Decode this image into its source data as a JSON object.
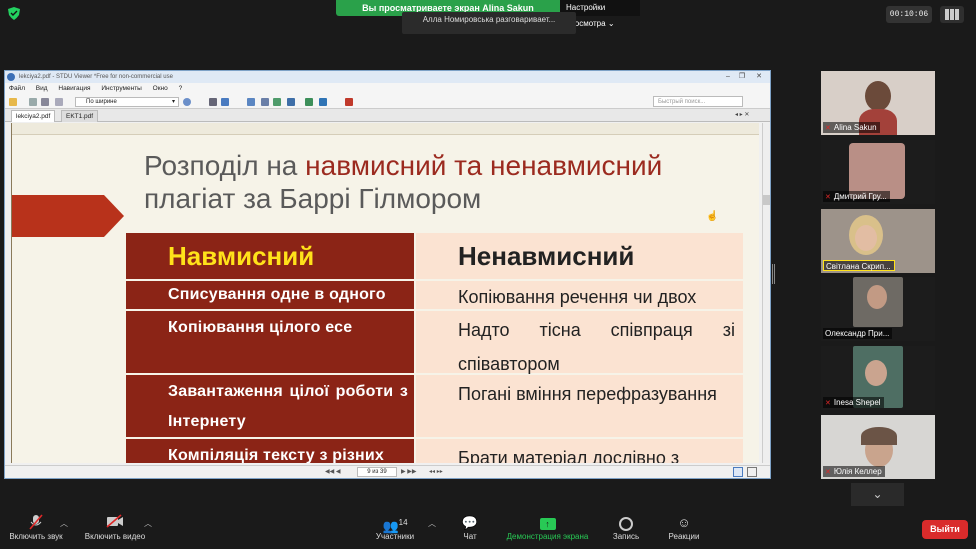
{
  "banner": {
    "viewing_text": "Вы просматриваете экран Alina Sakun",
    "view_options": "Настройки просмотра",
    "speaker_text": "Алла Номировська разговаривает..."
  },
  "timer": "00:10:06",
  "viewer": {
    "window_title": "lekciya2.pdf - STDU Viewer *Free for non-commercial use",
    "menu": [
      "Файл",
      "Вид",
      "Навигация",
      "Инструменты",
      "Окно",
      "?"
    ],
    "zoom": "По ширине",
    "search_placeholder": "Быстрый поиск...",
    "tabs": [
      "lekciya2.pdf",
      "EKT1.pdf"
    ],
    "page_indicator": "9 из 39"
  },
  "slide": {
    "title_part1": "Розподіл на ",
    "title_highlight": "навмисний та ненавмисний",
    "title_part2": "плагіат за Баррі Гілмором",
    "table": {
      "header_left": "Навмисний",
      "header_right": "Ненавмисний",
      "rows": [
        {
          "left": "Списування одне в одного",
          "right": "Копіювання речення чи двох"
        },
        {
          "left": "Копіювання цілого есе",
          "right": "Надто тісна співпраця зі співавтором"
        },
        {
          "left": "Завантаження цілої роботи з Інтернету",
          "right": "Погані вміння перефразування"
        },
        {
          "left": "Компіляція тексту з різних",
          "right": "Брати матеріал дослівно з"
        }
      ]
    }
  },
  "participants": [
    {
      "name": "Alina Sakun"
    },
    {
      "name": "Дмитрий Гру..."
    },
    {
      "name": "Світлана Скрип..."
    },
    {
      "name": "Олександр При..."
    },
    {
      "name": "Inesa Shepel"
    },
    {
      "name": "Юлія Келлер"
    }
  ],
  "toolbar": {
    "mute": "Включить звук",
    "video": "Включить видео",
    "participants": "Участники",
    "participants_count": "14",
    "chat": "Чат",
    "share": "Демонстрация экрана",
    "record": "Запись",
    "reactions": "Реакции",
    "leave": "Выйти"
  }
}
